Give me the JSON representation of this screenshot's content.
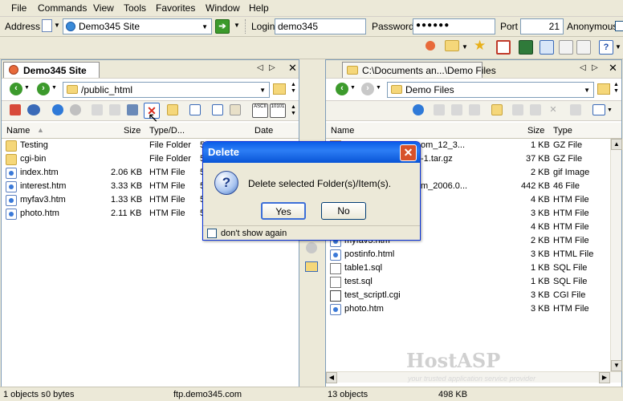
{
  "menu": [
    "File",
    "Commands",
    "View",
    "Tools",
    "Favorites",
    "Window",
    "Help"
  ],
  "address": {
    "label": "Address",
    "site": "Demo345 Site",
    "login_label": "Login",
    "login": "demo345",
    "password_label": "Password",
    "password": "●●●●●●",
    "port_label": "Port",
    "port": "21",
    "anonymous": "Anonymous"
  },
  "left_pane": {
    "tab": "Demo345 Site",
    "path": "/public_html",
    "columns": {
      "name": "Name",
      "size": "Size",
      "type": "Type/D...",
      "date": "Date"
    },
    "files": [
      {
        "name": "Testing",
        "size": "",
        "type": "File Folder",
        "date": "5",
        "icon": "folder"
      },
      {
        "name": "cgi-bin",
        "size": "",
        "type": "File Folder",
        "date": "5",
        "icon": "folder"
      },
      {
        "name": "index.htm",
        "size": "2.06 KB",
        "type": "HTM File",
        "date": "5",
        "icon": "htm"
      },
      {
        "name": "interest.htm",
        "size": "3.33 KB",
        "type": "HTM File",
        "date": "5",
        "icon": "htm"
      },
      {
        "name": "myfav3.htm",
        "size": "1.33 KB",
        "type": "HTM File",
        "date": "5",
        "icon": "htm"
      },
      {
        "name": "photo.htm",
        "size": "2.11 KB",
        "type": "HTM File",
        "date": "5",
        "icon": "htm"
      }
    ],
    "status_objects": "1 objects s",
    "status_bytes": "0 bytes"
  },
  "right_pane": {
    "tab": "C:\\Documents an...\\Demo Files",
    "path": "Demo Files",
    "columns": {
      "name": "Name",
      "size": "Size",
      "type": "Type"
    },
    "files": [
      {
        "name": "om_12_3...",
        "size": "1 KB",
        "type": "GZ File",
        "icon": "gz"
      },
      {
        "name": "-1.tar.gz",
        "size": "37 KB",
        "type": "GZ File",
        "icon": "gz"
      },
      {
        "name": "",
        "size": "2 KB",
        "type": "gif Image",
        "icon": "gif"
      },
      {
        "name": "m_2006.0...",
        "size": "442 KB",
        "type": "46 File",
        "icon": "file"
      },
      {
        "name": "",
        "size": "4 KB",
        "type": "HTM File",
        "icon": "htm"
      },
      {
        "name": "",
        "size": "3 KB",
        "type": "HTM File",
        "icon": "htm"
      },
      {
        "name": "",
        "size": "4 KB",
        "type": "HTM File",
        "icon": "htm"
      },
      {
        "name": "myfav3.htm",
        "size": "2 KB",
        "type": "HTM File",
        "icon": "htm"
      },
      {
        "name": "postinfo.html",
        "size": "3 KB",
        "type": "HTML File",
        "icon": "htm"
      },
      {
        "name": "table1.sql",
        "size": "1 KB",
        "type": "SQL File",
        "icon": "sql"
      },
      {
        "name": "test.sql",
        "size": "1 KB",
        "type": "SQL File",
        "icon": "sql"
      },
      {
        "name": "test_scriptl.cgi",
        "size": "3 KB",
        "type": "CGI File",
        "icon": "cgi"
      },
      {
        "name": "photo.htm",
        "size": "3 KB",
        "type": "HTM File",
        "icon": "htm"
      }
    ],
    "status_objects": "13 objects",
    "status_size": "498 KB"
  },
  "status_host": "ftp.demo345.com",
  "dialog": {
    "title": "Delete",
    "message": "Delete selected Folder(s)/Item(s).",
    "yes": "Yes",
    "no": "No",
    "dont_show": "don't show again"
  },
  "watermark": {
    "brand": "HostASP",
    "tagline": "your trusted application service provider"
  },
  "colors": {
    "title_bar": "#0a5de8",
    "close_button": "#d7522b",
    "accent_green": "#3c9a2c"
  }
}
